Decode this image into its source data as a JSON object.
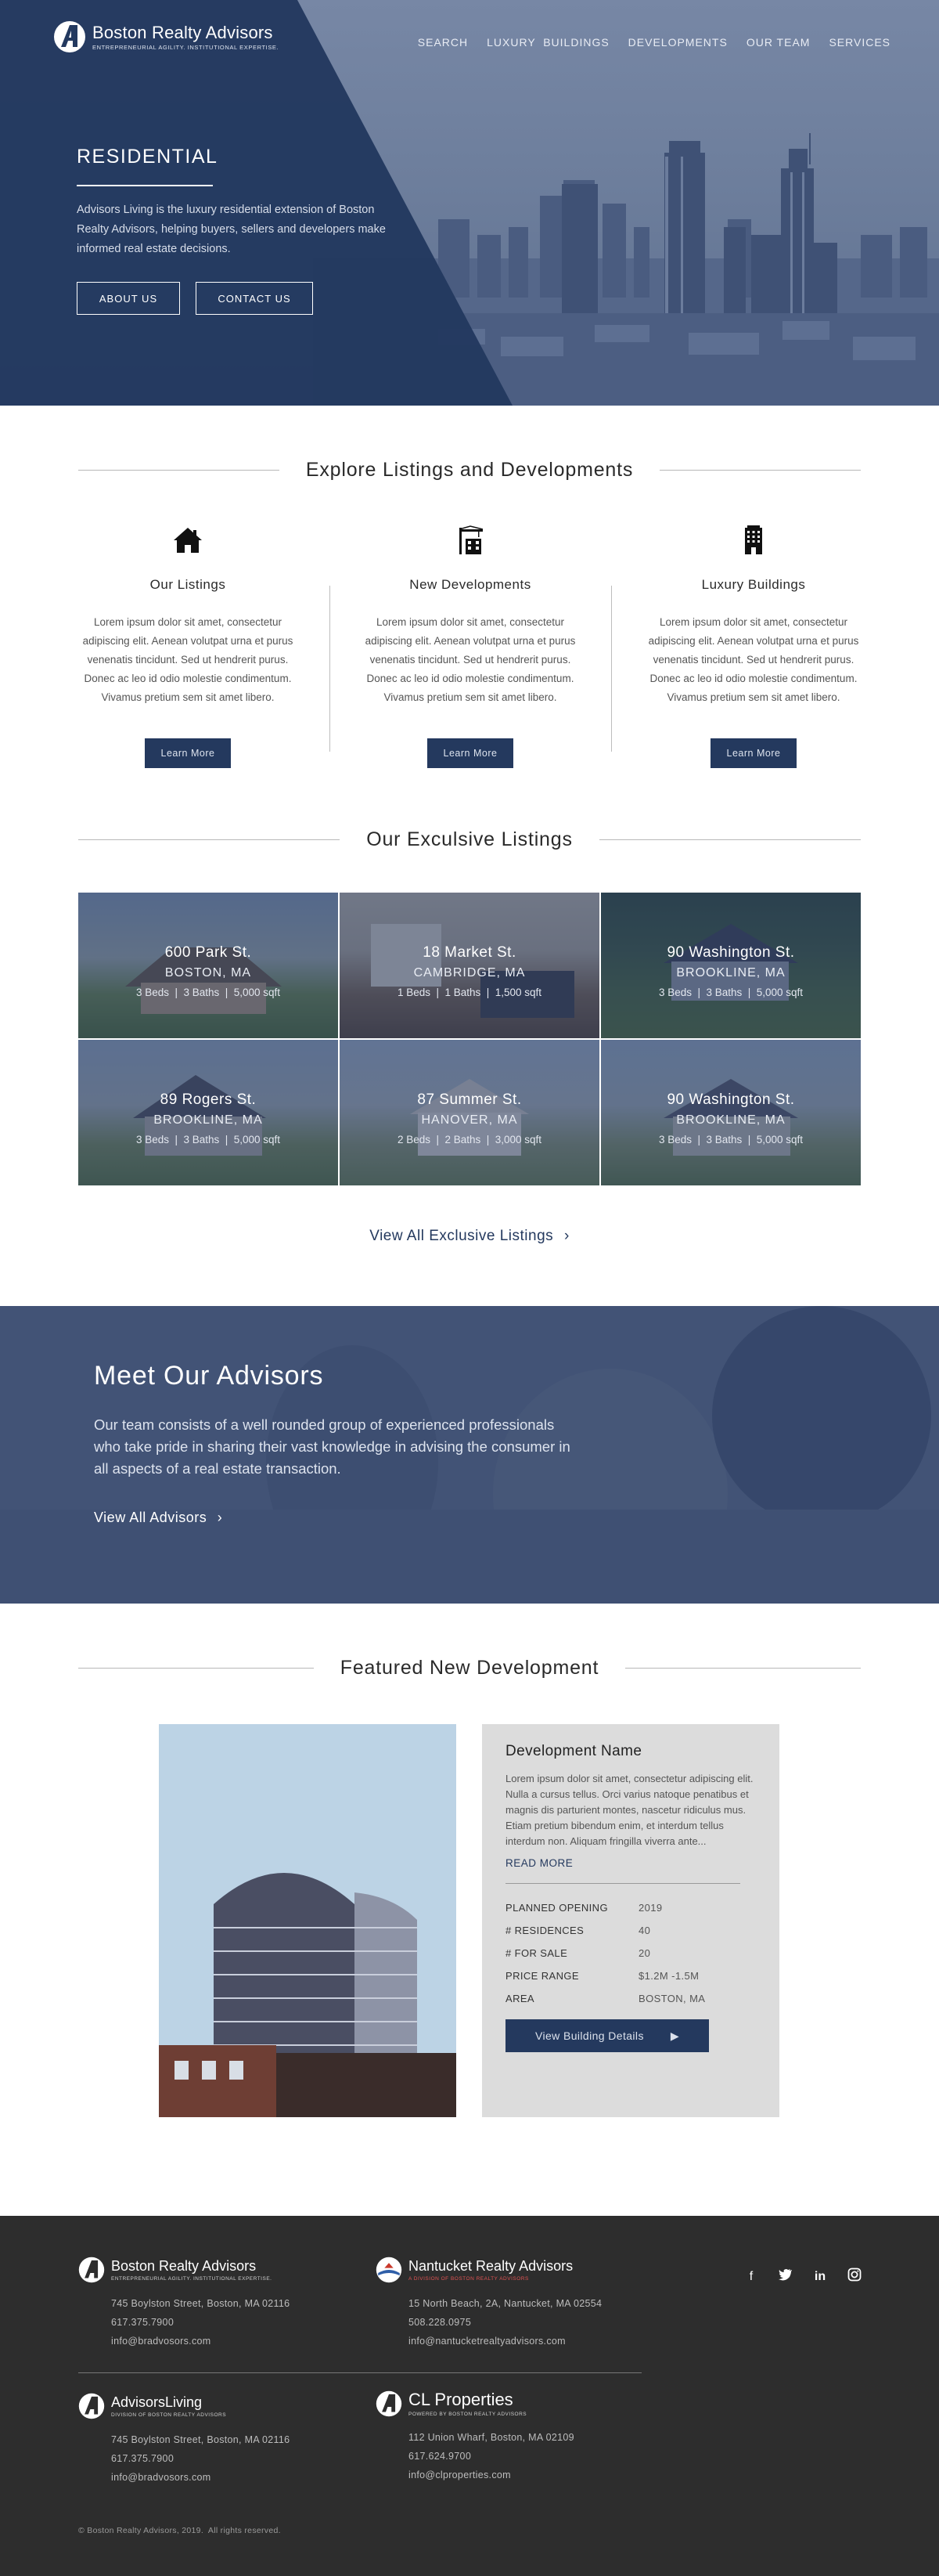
{
  "brand": {
    "name": "Boston Realty Advisors",
    "tagline": "ENTREPRENEURIAL AGILITY. INSTITUTIONAL EXPERTISE."
  },
  "nav": {
    "items": [
      "SEARCH",
      "LUXURY  BUILDINGS",
      "DEVELOPMENTS",
      "OUR TEAM",
      "SERVICES"
    ]
  },
  "hero": {
    "title": "RESIDENTIAL",
    "text": "Advisors Living is the luxury residential extension of Boston Realty Advisors, helping buyers, sellers and developers make informed real estate decisions.",
    "buttons": [
      "ABOUT US",
      "CONTACT US"
    ]
  },
  "explore": {
    "heading": "Explore Listings and Developments",
    "columns": [
      {
        "icon": "house-icon",
        "title": "Our Listings",
        "body": "Lorem ipsum dolor sit amet, consectetur adipiscing elit. Aenean volutpat urna et purus venenatis tincidunt. Sed ut hendrerit purus. Donec ac leo id odio molestie condimentum. Vivamus pretium sem sit amet libero.",
        "button": "Learn More"
      },
      {
        "icon": "construction-crane-icon",
        "title": "New Developments",
        "body": "Lorem ipsum dolor sit amet, consectetur adipiscing elit. Aenean volutpat urna et purus venenatis tincidunt. Sed ut hendrerit purus. Donec ac leo id odio molestie condimentum. Vivamus pretium sem sit amet libero.",
        "button": "Learn More"
      },
      {
        "icon": "building-icon",
        "title": "Luxury Buildings",
        "body": "Lorem ipsum dolor sit amet, consectetur adipiscing elit. Aenean volutpat urna et purus venenatis tincidunt. Sed ut hendrerit purus. Donec ac leo id odio molestie condimentum. Vivamus pretium sem sit amet libero.",
        "button": "Learn More"
      }
    ]
  },
  "listings": {
    "heading": "Our Exculsive Listings",
    "items": [
      {
        "address": "600 Park St.",
        "city": "BOSTON, MA",
        "meta": "3 Beds  |  3 Baths  |  5,000 sqft"
      },
      {
        "address": "18 Market St.",
        "city": "CAMBRIDGE, MA",
        "meta": "1 Beds  |  1 Baths  |  1,500 sqft"
      },
      {
        "address": "90 Washington St.",
        "city": "BROOKLINE, MA",
        "meta": "3 Beds  |  3 Baths  |  5,000 sqft"
      },
      {
        "address": "89 Rogers St.",
        "city": "BROOKLINE, MA",
        "meta": "3 Beds  |  3 Baths  |  5,000 sqft"
      },
      {
        "address": "87 Summer St.",
        "city": "HANOVER, MA",
        "meta": "2 Beds  |  2 Baths  |  3,000 sqft"
      },
      {
        "address": "90 Washington St.",
        "city": "BROOKLINE, MA",
        "meta": "3 Beds  |  3 Baths  |  5,000 sqft"
      }
    ],
    "view_all": "View All Exclusive Listings"
  },
  "advisors": {
    "heading": "Meet Our Advisors",
    "text": "Our team consists of a well rounded group of experienced professionals who take pride in sharing their vast knowledge in advising the consumer in all aspects of a real estate transaction.",
    "link": "View All Advisors"
  },
  "featured": {
    "heading": "Featured New Development",
    "name": "Development Name",
    "description": "Lorem ipsum dolor sit amet, consectetur adipiscing elit. Nulla a cursus tellus. Orci varius natoque penatibus et magnis dis parturient montes, nascetur ridiculus mus. Etiam pretium bibendum enim, et interdum tellus interdum non. Aliquam fringilla viverra ante...",
    "read_more": "READ MORE",
    "facts": [
      {
        "label": "PLANNED OPENING",
        "value": "2019"
      },
      {
        "label": "# RESIDENCES",
        "value": "40"
      },
      {
        "label": "# FOR SALE",
        "value": "20"
      },
      {
        "label": "PRICE RANGE",
        "value": "$1.2M -1.5M"
      },
      {
        "label": "AREA",
        "value": "BOSTON, MA"
      }
    ],
    "cta": "View Building Details"
  },
  "footer": {
    "companies": [
      {
        "name": "Boston Realty Advisors",
        "tagline": "ENTREPRENEURIAL AGILITY. INSTITUTIONAL EXPERTISE.",
        "address": "745 Boylston Street, Boston, MA 02116",
        "phone": "617.375.7900",
        "email": "info@bradvosors.com"
      },
      {
        "name": "Nantucket Realty Advisors",
        "tagline": "A DIVISION OF BOSTON REALTY ADVISORS",
        "address": "15 North Beach, 2A, Nantucket, MA 02554",
        "phone": "508.228.0975",
        "email": "info@nantucketrealtyadvisors.com"
      },
      {
        "name": "AdvisorsLiving",
        "tagline": "DIVISION OF BOSTON REALTY ADVISORS",
        "address": "745 Boylston Street, Boston, MA 02116",
        "phone": "617.375.7900",
        "email": "info@bradvosors.com"
      },
      {
        "name": "CL Properties",
        "tagline": "POWERED BY BOSTON REALTY ADVISORS",
        "address": "112 Union Wharf, Boston, MA 02109",
        "phone": "617.624.9700",
        "email": "info@clproperties.com"
      }
    ],
    "social": [
      "facebook-icon",
      "twitter-icon",
      "linkedin-icon",
      "instagram-icon"
    ],
    "copyright": "Boston Realty Advisors, 2019.  All rights reserved."
  },
  "colors": {
    "navy": "#24395e",
    "footer_bg": "#2d2d2d",
    "card_bg": "#dcdcdc"
  }
}
